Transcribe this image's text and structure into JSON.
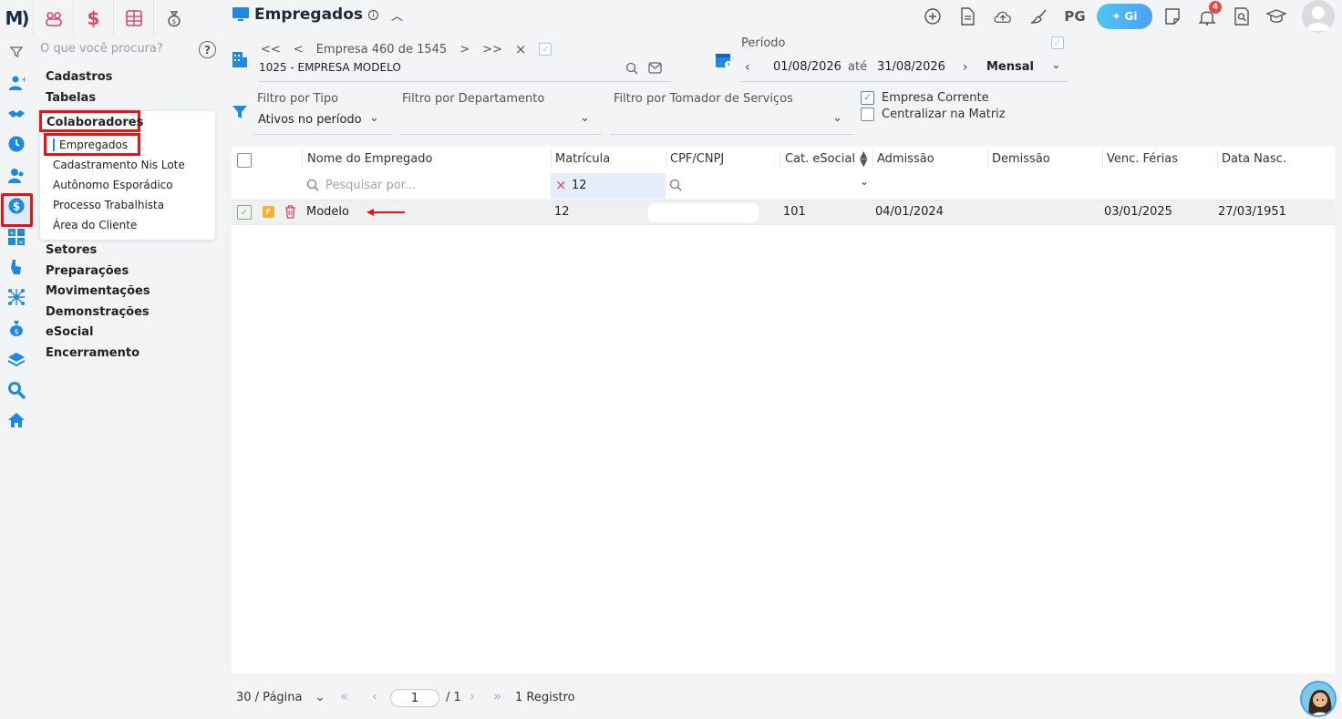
{
  "brand": {
    "logo": "M)"
  },
  "top_tabs": [
    {
      "name": "people-group-icon",
      "glyph": "☺"
    },
    {
      "name": "dollar-icon",
      "glyph": "$"
    },
    {
      "name": "calculator-icon",
      "glyph": "▦"
    },
    {
      "name": "money-bag-icon",
      "glyph": "$"
    }
  ],
  "menu": {
    "search_placeholder": "O que você procura?",
    "help_glyph": "?",
    "items": [
      "Cadastros",
      "Tabelas",
      "Colaboradores",
      "Setores",
      "Preparações",
      "Movimentações",
      "Demonstrações",
      "eSocial",
      "Encerramento"
    ],
    "submenu": [
      "Empregados",
      "Cadastramento Nis Lote",
      "Autônomo Esporádico",
      "Processo Trabalhista",
      "Área do Cliente"
    ]
  },
  "header": {
    "title": "Empregados",
    "user_initials": "PG",
    "gi_label": "Gi",
    "notif_count": "4"
  },
  "company": {
    "nav_first": "<<",
    "nav_prev": "<",
    "position_text": "Empresa 460 de 1545",
    "nav_next": ">",
    "nav_last": ">>",
    "clear": "×",
    "value": "1025 - EMPRESA MODELO"
  },
  "period": {
    "label": "Período",
    "start": "01/08/2026",
    "between": "até",
    "end": "31/08/2026",
    "mode": "Mensal"
  },
  "filters": {
    "type_label": "Filtro por Tipo",
    "type_value": "Ativos no período",
    "dept_label": "Filtro por Departamento",
    "dept_value": "",
    "tomador_label": "Filtro por Tomador de Serviços",
    "tomador_value": "",
    "empresa_corrente": "Empresa Corrente",
    "empresa_corrente_checked": true,
    "centralizar": "Centralizar na Matriz",
    "centralizar_checked": false
  },
  "table": {
    "columns": [
      "Nome do Empregado",
      "Matrícula",
      "CPF/CNPJ",
      "Cat. eSocial",
      "Admissão",
      "Demissão",
      "Venc. Férias",
      "Data Nasc."
    ],
    "search_placeholder": "Pesquisar por...",
    "matricula_filter": "12",
    "rows": [
      {
        "badge": "F",
        "nome": "Modelo",
        "matricula": "12",
        "cpf": "",
        "cat": "101",
        "admissao": "04/01/2024",
        "demissao": "",
        "ferias": "03/01/2025",
        "nascimento": "27/03/1951"
      }
    ]
  },
  "pager": {
    "per_page": "30 / Página",
    "first": "«",
    "prev": "‹",
    "page": "1",
    "total": "/ 1",
    "next": "›",
    "last": "»",
    "records": "1 Registro"
  },
  "colors": {
    "accent": "#1e88e5",
    "highlight": "#e11111",
    "notif": "#ef4444"
  }
}
